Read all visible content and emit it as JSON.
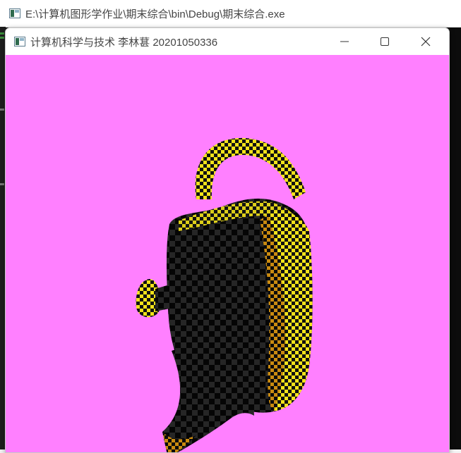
{
  "console": {
    "title": "E:\\计算机图形学作业\\期末综合\\bin\\Debug\\期末综合.exe",
    "icon": "console-app-icon"
  },
  "gl_window": {
    "title": "计算机科学与技术 李林葚 20201050336",
    "icon": "app-window-icon",
    "controls": {
      "minimize": "minimize-icon",
      "maximize": "maximize-icon",
      "close": "close-icon"
    },
    "canvas": {
      "background": "#ff80ff",
      "object": "checkerboard-textured-teapot",
      "texture_colors": [
        "#000000",
        "#ffff00"
      ]
    }
  }
}
